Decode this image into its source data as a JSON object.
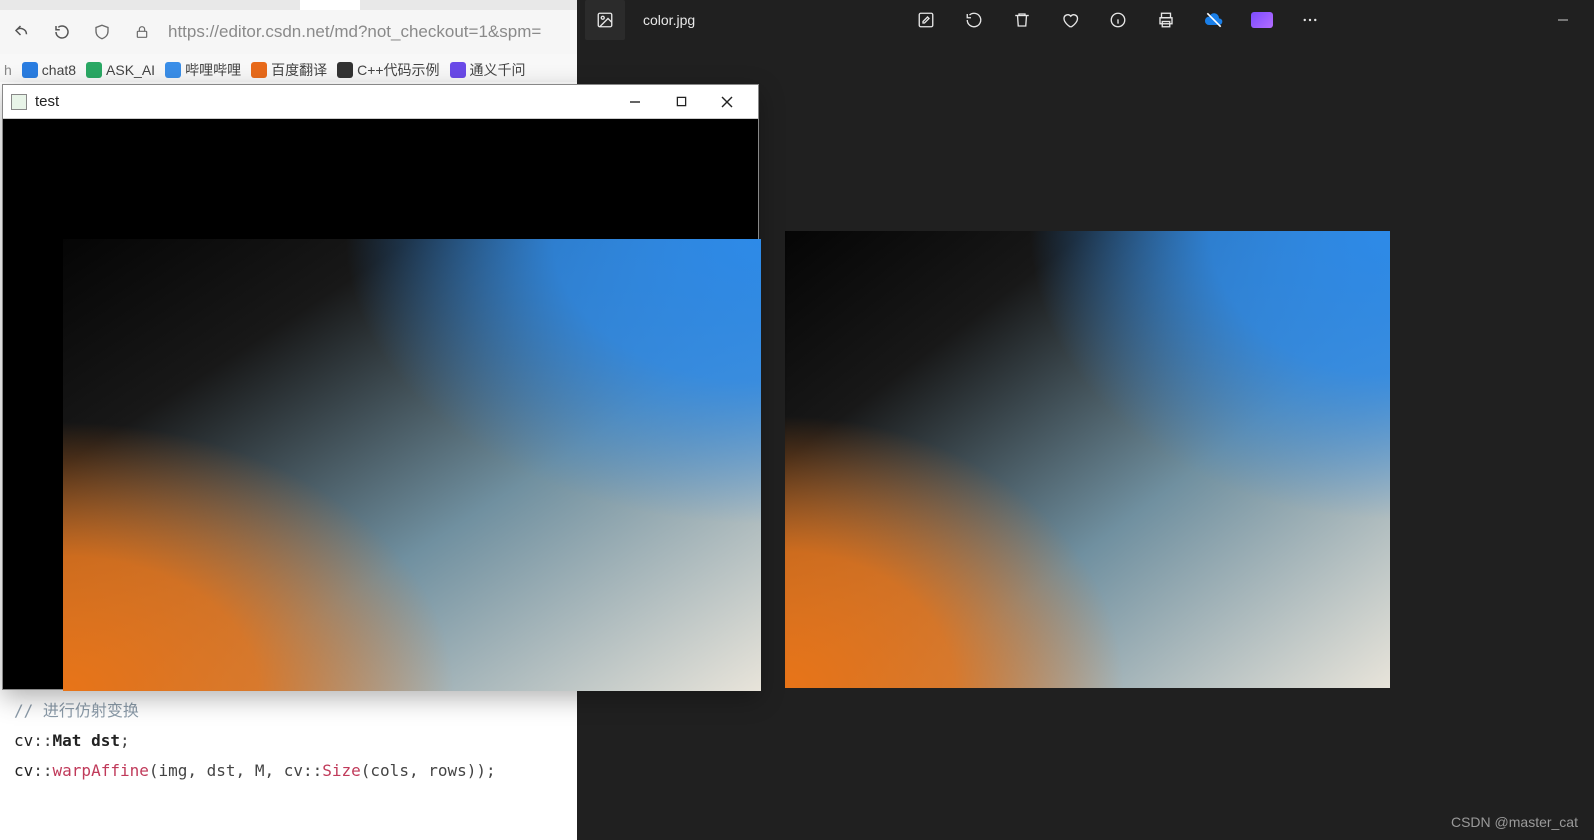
{
  "photos": {
    "filename": "color.jpg",
    "tools": {
      "edit": "edit-icon",
      "rotate": "rotate-icon",
      "delete": "trash-icon",
      "favorite": "heart-icon",
      "info": "info-icon",
      "print": "print-icon",
      "cloud": "cloud-icon",
      "clipchamp": "clipchamp-icon",
      "more": "more-icon"
    }
  },
  "browser": {
    "url": "https://editor.csdn.net/md?not_checkout=1&spm=",
    "bookmarks": [
      {
        "icon": "ic-blue",
        "label": "chat8"
      },
      {
        "icon": "ic-green",
        "label": "ASK_AI"
      },
      {
        "icon": "ic-blue2",
        "label": "哔哩哔哩"
      },
      {
        "icon": "ic-orange",
        "label": "百度翻译"
      },
      {
        "icon": "ic-dark",
        "label": "C++代码示例"
      },
      {
        "icon": "ic-purple",
        "label": "通义千问"
      }
    ]
  },
  "cv_window": {
    "title": "test"
  },
  "code": {
    "comment": "// 进行仿射变换",
    "line2_a": "cv",
    "line2_b": "::",
    "line2_c": "Mat dst",
    "line2_d": ";",
    "line3_a": "cv",
    "line3_b": "::",
    "line3_c": "warpAffine",
    "line3_d": "(img, dst, M, cv",
    "line3_e": "::",
    "line3_f": "Size",
    "line3_g": "(cols, rows))",
    "line3_h": ";"
  },
  "watermark": "CSDN @master_cat"
}
